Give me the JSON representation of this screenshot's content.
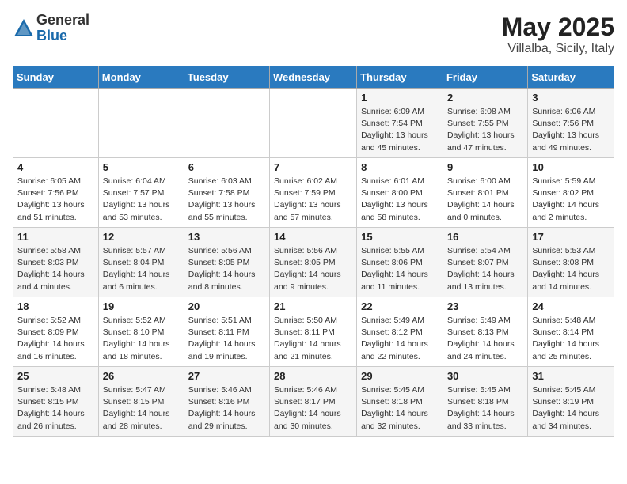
{
  "header": {
    "logo_general": "General",
    "logo_blue": "Blue",
    "month": "May 2025",
    "location": "Villalba, Sicily, Italy"
  },
  "weekdays": [
    "Sunday",
    "Monday",
    "Tuesday",
    "Wednesday",
    "Thursday",
    "Friday",
    "Saturday"
  ],
  "weeks": [
    [
      {
        "day": "",
        "info": ""
      },
      {
        "day": "",
        "info": ""
      },
      {
        "day": "",
        "info": ""
      },
      {
        "day": "",
        "info": ""
      },
      {
        "day": "1",
        "info": "Sunrise: 6:09 AM\nSunset: 7:54 PM\nDaylight: 13 hours\nand 45 minutes."
      },
      {
        "day": "2",
        "info": "Sunrise: 6:08 AM\nSunset: 7:55 PM\nDaylight: 13 hours\nand 47 minutes."
      },
      {
        "day": "3",
        "info": "Sunrise: 6:06 AM\nSunset: 7:56 PM\nDaylight: 13 hours\nand 49 minutes."
      }
    ],
    [
      {
        "day": "4",
        "info": "Sunrise: 6:05 AM\nSunset: 7:56 PM\nDaylight: 13 hours\nand 51 minutes."
      },
      {
        "day": "5",
        "info": "Sunrise: 6:04 AM\nSunset: 7:57 PM\nDaylight: 13 hours\nand 53 minutes."
      },
      {
        "day": "6",
        "info": "Sunrise: 6:03 AM\nSunset: 7:58 PM\nDaylight: 13 hours\nand 55 minutes."
      },
      {
        "day": "7",
        "info": "Sunrise: 6:02 AM\nSunset: 7:59 PM\nDaylight: 13 hours\nand 57 minutes."
      },
      {
        "day": "8",
        "info": "Sunrise: 6:01 AM\nSunset: 8:00 PM\nDaylight: 13 hours\nand 58 minutes."
      },
      {
        "day": "9",
        "info": "Sunrise: 6:00 AM\nSunset: 8:01 PM\nDaylight: 14 hours\nand 0 minutes."
      },
      {
        "day": "10",
        "info": "Sunrise: 5:59 AM\nSunset: 8:02 PM\nDaylight: 14 hours\nand 2 minutes."
      }
    ],
    [
      {
        "day": "11",
        "info": "Sunrise: 5:58 AM\nSunset: 8:03 PM\nDaylight: 14 hours\nand 4 minutes."
      },
      {
        "day": "12",
        "info": "Sunrise: 5:57 AM\nSunset: 8:04 PM\nDaylight: 14 hours\nand 6 minutes."
      },
      {
        "day": "13",
        "info": "Sunrise: 5:56 AM\nSunset: 8:05 PM\nDaylight: 14 hours\nand 8 minutes."
      },
      {
        "day": "14",
        "info": "Sunrise: 5:56 AM\nSunset: 8:05 PM\nDaylight: 14 hours\nand 9 minutes."
      },
      {
        "day": "15",
        "info": "Sunrise: 5:55 AM\nSunset: 8:06 PM\nDaylight: 14 hours\nand 11 minutes."
      },
      {
        "day": "16",
        "info": "Sunrise: 5:54 AM\nSunset: 8:07 PM\nDaylight: 14 hours\nand 13 minutes."
      },
      {
        "day": "17",
        "info": "Sunrise: 5:53 AM\nSunset: 8:08 PM\nDaylight: 14 hours\nand 14 minutes."
      }
    ],
    [
      {
        "day": "18",
        "info": "Sunrise: 5:52 AM\nSunset: 8:09 PM\nDaylight: 14 hours\nand 16 minutes."
      },
      {
        "day": "19",
        "info": "Sunrise: 5:52 AM\nSunset: 8:10 PM\nDaylight: 14 hours\nand 18 minutes."
      },
      {
        "day": "20",
        "info": "Sunrise: 5:51 AM\nSunset: 8:11 PM\nDaylight: 14 hours\nand 19 minutes."
      },
      {
        "day": "21",
        "info": "Sunrise: 5:50 AM\nSunset: 8:11 PM\nDaylight: 14 hours\nand 21 minutes."
      },
      {
        "day": "22",
        "info": "Sunrise: 5:49 AM\nSunset: 8:12 PM\nDaylight: 14 hours\nand 22 minutes."
      },
      {
        "day": "23",
        "info": "Sunrise: 5:49 AM\nSunset: 8:13 PM\nDaylight: 14 hours\nand 24 minutes."
      },
      {
        "day": "24",
        "info": "Sunrise: 5:48 AM\nSunset: 8:14 PM\nDaylight: 14 hours\nand 25 minutes."
      }
    ],
    [
      {
        "day": "25",
        "info": "Sunrise: 5:48 AM\nSunset: 8:15 PM\nDaylight: 14 hours\nand 26 minutes."
      },
      {
        "day": "26",
        "info": "Sunrise: 5:47 AM\nSunset: 8:15 PM\nDaylight: 14 hours\nand 28 minutes."
      },
      {
        "day": "27",
        "info": "Sunrise: 5:46 AM\nSunset: 8:16 PM\nDaylight: 14 hours\nand 29 minutes."
      },
      {
        "day": "28",
        "info": "Sunrise: 5:46 AM\nSunset: 8:17 PM\nDaylight: 14 hours\nand 30 minutes."
      },
      {
        "day": "29",
        "info": "Sunrise: 5:45 AM\nSunset: 8:18 PM\nDaylight: 14 hours\nand 32 minutes."
      },
      {
        "day": "30",
        "info": "Sunrise: 5:45 AM\nSunset: 8:18 PM\nDaylight: 14 hours\nand 33 minutes."
      },
      {
        "day": "31",
        "info": "Sunrise: 5:45 AM\nSunset: 8:19 PM\nDaylight: 14 hours\nand 34 minutes."
      }
    ]
  ]
}
